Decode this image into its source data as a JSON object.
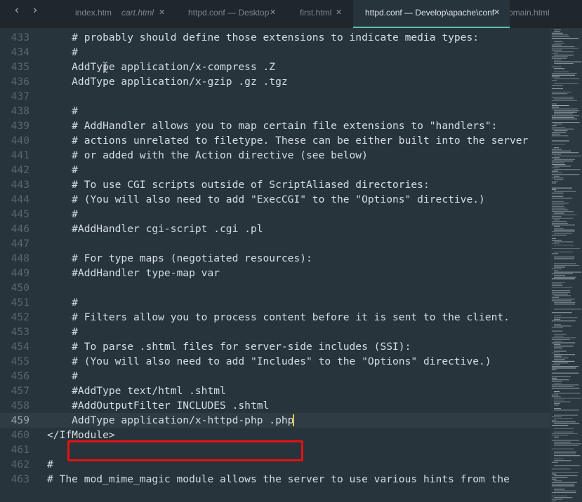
{
  "tabs": [
    {
      "label": "index.htm",
      "italic": false,
      "closable": false,
      "active": false
    },
    {
      "label": "cart.html",
      "italic": true,
      "closable": true,
      "active": false
    },
    {
      "label": "httpd.conf — Desktop",
      "italic": false,
      "closable": true,
      "active": false
    },
    {
      "label": "first.html",
      "italic": false,
      "closable": true,
      "active": false
    },
    {
      "label": "httpd.conf — Develop\\apache\\conf",
      "italic": false,
      "closable": true,
      "active": true
    },
    {
      "label": "omain.html",
      "italic": false,
      "closable": false,
      "active": false
    }
  ],
  "nav": {
    "back_icon": "‹",
    "forward_icon": "›",
    "close_icon": "✕"
  },
  "editor": {
    "current_line": 459,
    "lines": [
      {
        "num": "433",
        "text": "    # probably should define those extensions to indicate media types:"
      },
      {
        "num": "434",
        "text": "    #"
      },
      {
        "num": "435",
        "text": "    AddType application/x-compress .Z"
      },
      {
        "num": "436",
        "text": "    AddType application/x-gzip .gz .tgz"
      },
      {
        "num": "437",
        "text": ""
      },
      {
        "num": "438",
        "text": "    #"
      },
      {
        "num": "439",
        "text": "    # AddHandler allows you to map certain file extensions to \"handlers\":"
      },
      {
        "num": "440",
        "text": "    # actions unrelated to filetype. These can be either built into the server"
      },
      {
        "num": "441",
        "text": "    # or added with the Action directive (see below)"
      },
      {
        "num": "442",
        "text": "    #"
      },
      {
        "num": "443",
        "text": "    # To use CGI scripts outside of ScriptAliased directories:"
      },
      {
        "num": "444",
        "text": "    # (You will also need to add \"ExecCGI\" to the \"Options\" directive.)"
      },
      {
        "num": "445",
        "text": "    #"
      },
      {
        "num": "446",
        "text": "    #AddHandler cgi-script .cgi .pl"
      },
      {
        "num": "447",
        "text": ""
      },
      {
        "num": "448",
        "text": "    # For type maps (negotiated resources):"
      },
      {
        "num": "449",
        "text": "    #AddHandler type-map var"
      },
      {
        "num": "450",
        "text": ""
      },
      {
        "num": "451",
        "text": "    #"
      },
      {
        "num": "452",
        "text": "    # Filters allow you to process content before it is sent to the client."
      },
      {
        "num": "453",
        "text": "    #"
      },
      {
        "num": "454",
        "text": "    # To parse .shtml files for server-side includes (SSI):"
      },
      {
        "num": "455",
        "text": "    # (You will also need to add \"Includes\" to the \"Options\" directive.)"
      },
      {
        "num": "456",
        "text": "    #"
      },
      {
        "num": "457",
        "text": "    #AddType text/html .shtml"
      },
      {
        "num": "458",
        "text": "    #AddOutputFilter INCLUDES .shtml"
      },
      {
        "num": "459",
        "text": "    AddType application/x-httpd-php .php"
      },
      {
        "num": "460",
        "text": "</IfModule>"
      },
      {
        "num": "461",
        "text": ""
      },
      {
        "num": "462",
        "text": "#"
      },
      {
        "num": "463",
        "text": "# The mod_mime_magic module allows the server to use various hints from the"
      }
    ]
  },
  "colors": {
    "background": "#28343c",
    "tabbar": "#1f272c",
    "accent": "#5ec1ad",
    "annotation_box": "#e81010",
    "caret": "#e8c843"
  }
}
